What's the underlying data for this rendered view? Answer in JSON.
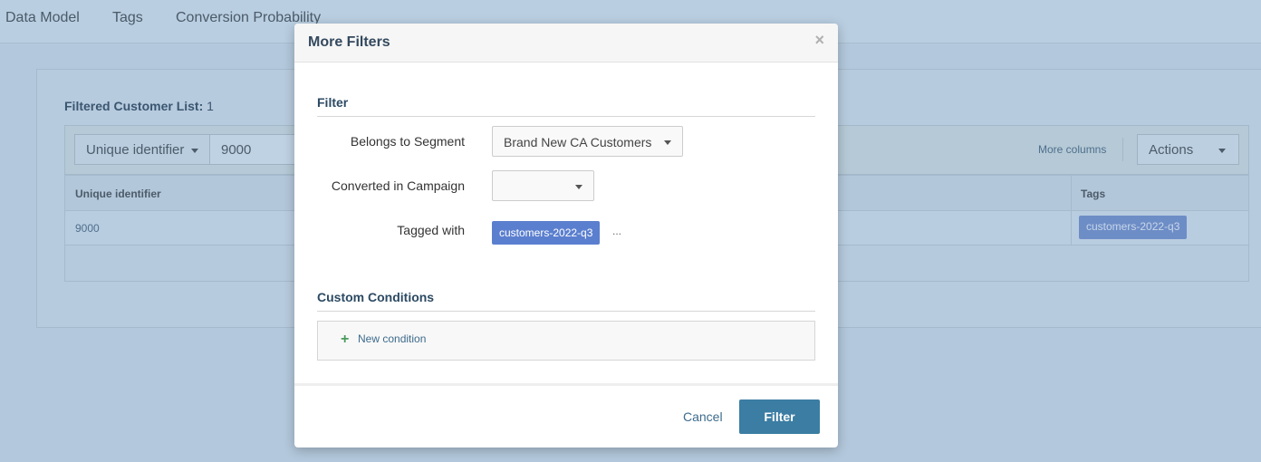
{
  "topnav": {
    "items": [
      "Data Model",
      "Tags",
      "Conversion Probability"
    ]
  },
  "list": {
    "title": "Filtered Customer List:",
    "count": "1",
    "field_select": "Unique identifier",
    "field_value": "9000",
    "more_columns": "More columns",
    "actions": "Actions",
    "columns": {
      "id": "Unique identifier",
      "tags": "Tags"
    },
    "rows": [
      {
        "id": "9000",
        "tag": "customers-2022-q3"
      }
    ]
  },
  "modal": {
    "title": "More Filters",
    "close": "×",
    "filter_section": "Filter",
    "segment_label": "Belongs to Segment",
    "segment_value": "Brand New CA Customers",
    "campaign_label": "Converted in Campaign",
    "campaign_value": "",
    "tagged_label": "Tagged with",
    "tag_value": "customers-2022-q3",
    "tag_more": "...",
    "custom_section": "Custom Conditions",
    "plus_icon": "+",
    "new_condition": "New condition",
    "cancel": "Cancel",
    "filter_button": "Filter"
  },
  "colors": {
    "primary": "#3b7da3",
    "tag": "#5b7fcf",
    "title": "#34495e",
    "overlay": "#b3c8dc"
  }
}
